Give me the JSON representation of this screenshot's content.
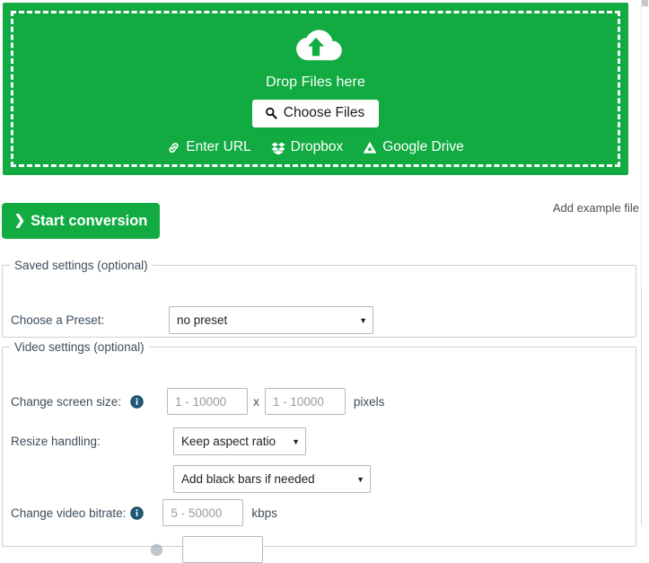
{
  "dropzone": {
    "icon": "cloud-upload-icon",
    "drop_text": "Drop Files here",
    "choose_files_label": "Choose Files",
    "choose_files_icon": "search-icon",
    "services": [
      {
        "label": "Enter URL",
        "icon": "link-icon"
      },
      {
        "label": "Dropbox",
        "icon": "dropbox-icon"
      },
      {
        "label": "Google Drive",
        "icon": "google-drive-icon"
      }
    ],
    "background_color": "#11ab41"
  },
  "actions": {
    "start_conversion_label": "Start conversion",
    "start_conversion_chevron": "❯",
    "add_example_file_label": "Add example file",
    "button_color": "#12ab42"
  },
  "saved_settings": {
    "legend": "Saved settings (optional)",
    "preset": {
      "label": "Choose a Preset:",
      "value": "no preset",
      "options": [
        "no preset"
      ]
    }
  },
  "video_settings": {
    "legend": "Video settings (optional)",
    "screen_size": {
      "label": "Change screen size:",
      "info_icon": "info-icon",
      "width_placeholder": "1 - 10000",
      "width_value": "",
      "separator": "x",
      "height_placeholder": "1 - 10000",
      "height_value": "",
      "unit": "pixels"
    },
    "resize_handling": {
      "label": "Resize handling:",
      "aspect": {
        "value": "Keep aspect ratio",
        "options": [
          "Keep aspect ratio"
        ]
      },
      "bars": {
        "value": "Add black bars if needed",
        "options": [
          "Add black bars if needed"
        ]
      }
    },
    "video_bitrate": {
      "label": "Change video bitrate:",
      "info_icon": "info-icon",
      "placeholder": "5 - 50000",
      "value": "",
      "unit": "kbps"
    }
  }
}
